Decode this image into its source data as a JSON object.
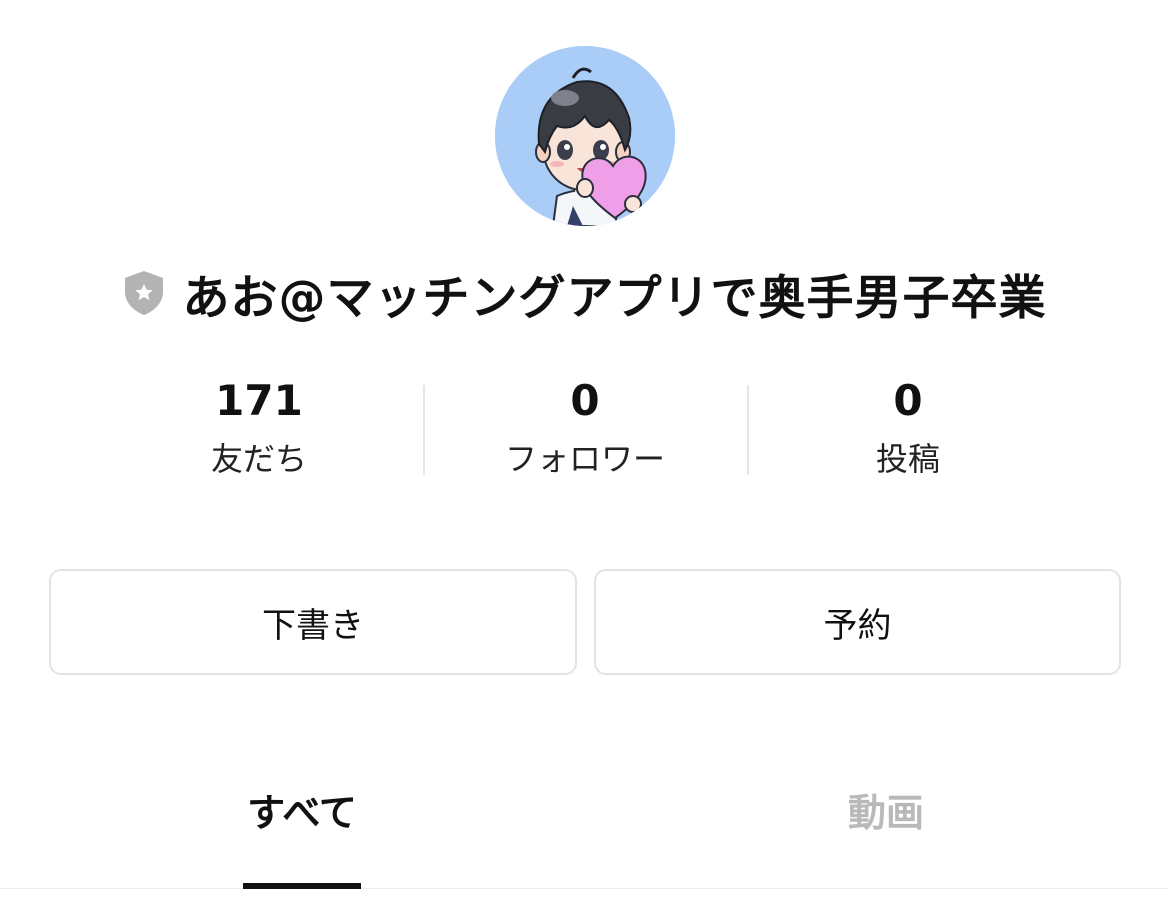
{
  "profile": {
    "avatar_icon": "anime-boy-holding-heart-avatar",
    "badge_icon": "shield-star-icon",
    "name": "あお@マッチングアプリで奥手男子卒業"
  },
  "stats": [
    {
      "value": "171",
      "label": "友だち"
    },
    {
      "value": "0",
      "label": "フォロワー"
    },
    {
      "value": "0",
      "label": "投稿"
    }
  ],
  "actions": {
    "drafts_label": "下書き",
    "scheduled_label": "予約"
  },
  "tabs": [
    {
      "label": "すべて",
      "active": true
    },
    {
      "label": "動画",
      "active": false
    }
  ],
  "colors": {
    "avatar_background": "#a9cdf7",
    "active_tab": "#111111",
    "inactive_tab": "#b9b9b9",
    "badge": "#b3b3b3"
  }
}
